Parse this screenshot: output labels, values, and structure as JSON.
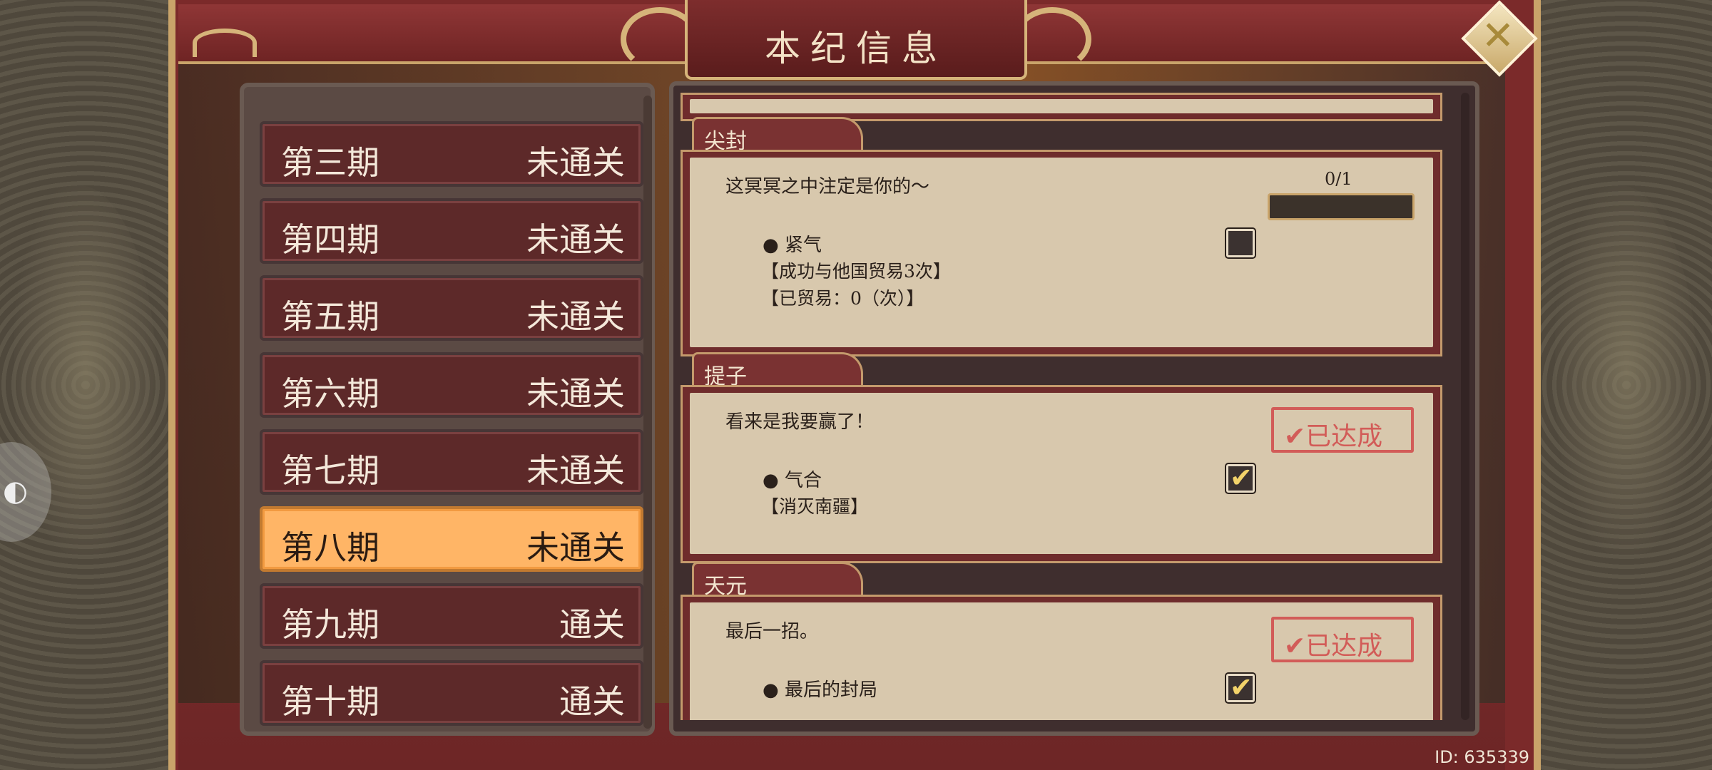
{
  "title": "本纪信息",
  "close_label": "✕",
  "periods": [
    {
      "name": "第三期",
      "status": "未通关",
      "selected": false
    },
    {
      "name": "第四期",
      "status": "未通关",
      "selected": false
    },
    {
      "name": "第五期",
      "status": "未通关",
      "selected": false
    },
    {
      "name": "第六期",
      "status": "未通关",
      "selected": false
    },
    {
      "name": "第七期",
      "status": "未通关",
      "selected": false
    },
    {
      "name": "第八期",
      "status": "未通关",
      "selected": true
    },
    {
      "name": "第九期",
      "status": "通关",
      "selected": false
    },
    {
      "name": "第十期",
      "status": "通关",
      "selected": false
    }
  ],
  "achievements": [
    {
      "tab": "尖封",
      "quote": "这冥冥之中注定是你的～",
      "progress_label": "0/1",
      "progress": 0,
      "condition": "● 紧气",
      "desc": [
        "【成功与他国贸易3次】",
        "【已贸易：0（次）】"
      ],
      "checked": false,
      "stamp": ""
    },
    {
      "tab": "提子",
      "quote": "看来是我要赢了！",
      "progress_label": "",
      "condition": "● 气合",
      "desc": [
        "【消灭南疆】"
      ],
      "checked": true,
      "stamp": "✔已达成"
    },
    {
      "tab": "天元",
      "quote": "最后一招。",
      "progress_label": "",
      "condition": "● 最后的封局",
      "desc": [],
      "checked": true,
      "stamp": "✔已达成"
    }
  ],
  "id_text": "ID: 635339",
  "colors": {
    "selected": "#ffb566",
    "item": "#5d2929",
    "paper": "#d8c8ad",
    "stamp": "#d24a4a"
  }
}
